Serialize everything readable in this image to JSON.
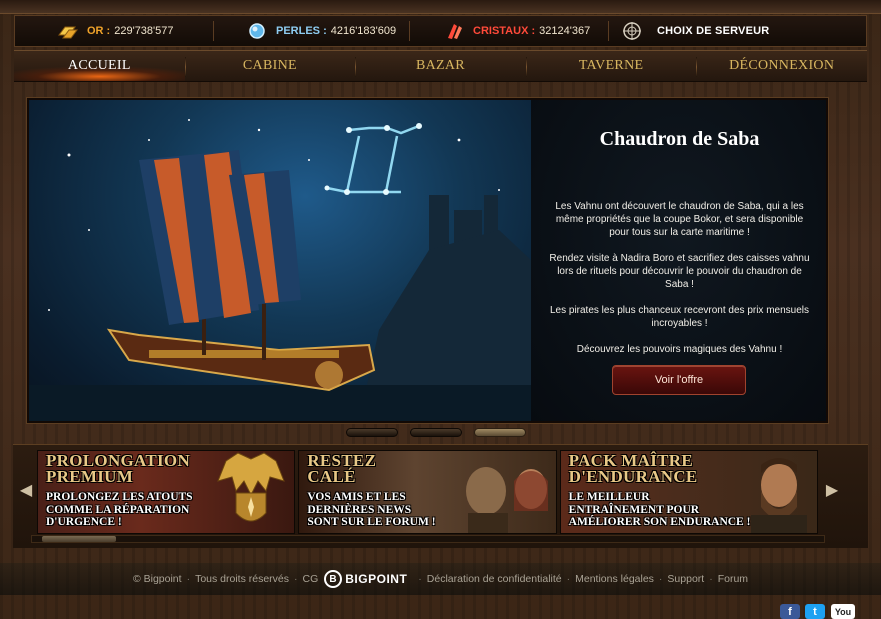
{
  "resources": {
    "gold": {
      "label": "OR :",
      "value": "229'738'577",
      "color": "#f0a32a",
      "icon": "gold-bars-icon"
    },
    "pearls": {
      "label": "PERLES :",
      "value": "4216'183'609",
      "color": "#8ecdf2",
      "icon": "pearl-icon"
    },
    "crystals": {
      "label": "CRISTAUX :",
      "value": "32124'367",
      "color": "#ff4a3a",
      "icon": "crystal-icon"
    },
    "server": {
      "label": "CHOIX DE SERVEUR",
      "icon": "crosshair-globe-icon"
    }
  },
  "nav": {
    "items": [
      {
        "label": "ACCUEIL",
        "active": true
      },
      {
        "label": "CABINE"
      },
      {
        "label": "BAZAR"
      },
      {
        "label": "TAVERNE"
      },
      {
        "label": "DÉCONNEXION"
      }
    ]
  },
  "banner": {
    "title": "Chaudron de Saba",
    "paragraphs": [
      "Les Vahnu ont découvert le chaudron de Saba, qui a les même propriétés que la coupe Bokor, et sera disponible pour tous sur la carte maritime !",
      "Rendez visite à Nadira Boro et sacrifiez des caisses vahnu lors de rituels pour découvrir le pouvoir du chaudron de Saba !",
      "Les pirates les plus chanceux recevront des prix mensuels incroyables !",
      "Découvrez les pouvoirs magiques des Vahnu !"
    ],
    "button": "Voir l'offre",
    "slides": 3,
    "active_slide": 3
  },
  "promos": [
    {
      "title_1": "PROLONGATION",
      "title_2": "PREMIUM",
      "text_1": "PROLONGEZ LES ATOUTS",
      "text_2": "COMME LA RÉPARATION",
      "text_3": "D'URGENCE !"
    },
    {
      "title_1": "RESTEZ",
      "title_2": "CALÉ",
      "text_1": "VOS AMIS ET LES",
      "text_2": "DERNIÈRES NEWS",
      "text_3": "SONT SUR LE FORUM !"
    },
    {
      "title_1": "PACK MAÎTRE",
      "title_2": "D'ENDURANCE",
      "text_1": "LE MEILLEUR",
      "text_2": "ENTRAÎNEMENT POUR",
      "text_3": "AMÉLIORER SON ENDURANCE !"
    }
  ],
  "footer": {
    "copyright": "© Bigpoint",
    "rights": "Tous droits réservés",
    "cg": "CG",
    "logo": "BIGPOINT",
    "privacy": "Déclaration de confidentialité",
    "legal": "Mentions légales",
    "support": "Support",
    "forum": "Forum"
  },
  "social": {
    "facebook": "f",
    "twitter": "t",
    "youtube": "You"
  }
}
